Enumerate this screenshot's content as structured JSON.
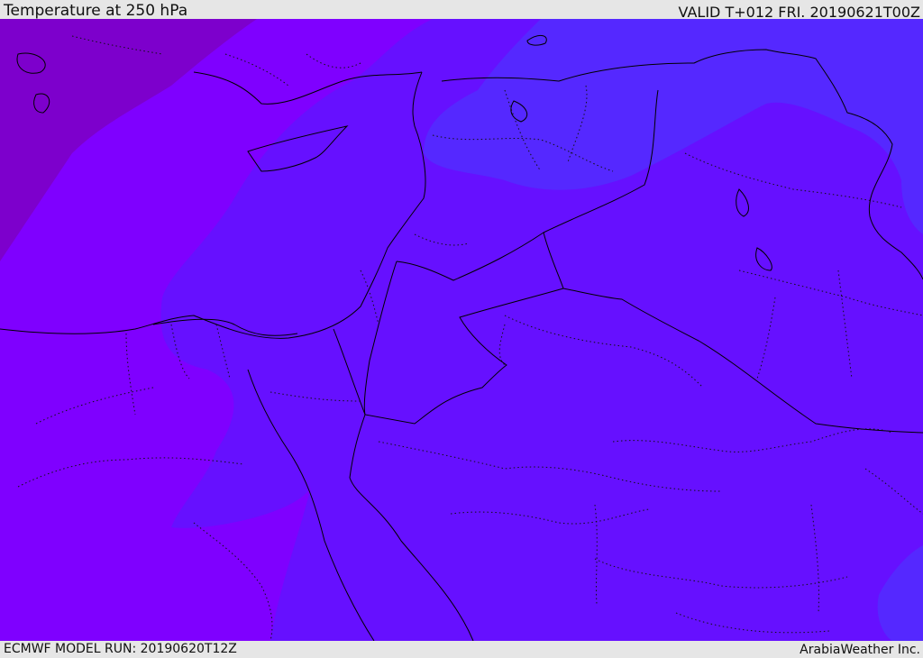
{
  "header": {
    "title": "Temperature at 250 hPa",
    "valid": "VALID T+012 FRI. 20190621T00Z"
  },
  "footer": {
    "model_run": "ECMWF MODEL RUN: 20190620T12Z",
    "credit": "ArabiaWeather Inc."
  },
  "colors": {
    "band_coldest": "#7d00cc",
    "band_cold": "#7f00ff",
    "band_mid": "#6610ff",
    "band_warm": "#5528ff",
    "borders": "#000000",
    "panel": "#e6e6e6"
  }
}
